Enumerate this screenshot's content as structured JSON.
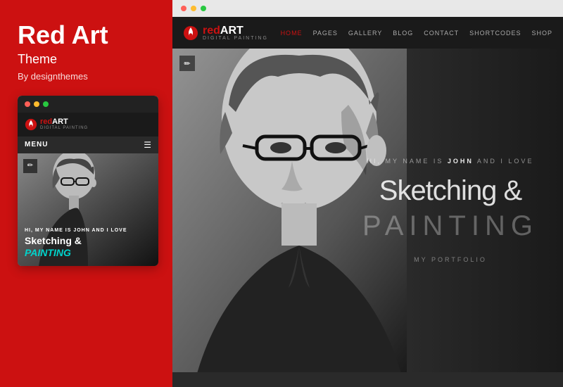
{
  "left": {
    "title": "Red Art",
    "subtitle": "Theme",
    "author": "By designthemes",
    "mobile_preview": {
      "logo_red": "red",
      "logo_bold": "ART",
      "logo_sub": "DIGITAL PAINTING",
      "menu_label": "MENU",
      "intro": "HI, MY NAME IS",
      "intro_name": "JOHN",
      "intro_suffix": "AND I LOVE",
      "heading1": "Sketching &",
      "heading2": "PAINTING"
    }
  },
  "right": {
    "desktop_preview": {
      "logo_red": "red",
      "logo_bold": "ART",
      "logo_sub": "DIGITAL PAINTING",
      "nav_links": [
        "HOME",
        "PAGES",
        "GALLERY",
        "BLOG",
        "CONTACT",
        "SHORTCODES",
        "SHOP"
      ],
      "active_nav": "HOME",
      "intro": "HI, MY NAME IS",
      "intro_name": "JOHN",
      "intro_suffix": "AND I LOVE",
      "heading1": "Sketching &",
      "heading2": "PAINTING",
      "portfolio_label": "MY PORTFOLIO"
    }
  },
  "colors": {
    "red": "#cc1111",
    "accent": "#00d4cc",
    "dark": "#1a1a1a"
  },
  "icons": {
    "pencil": "✏",
    "hamburger": "≡",
    "dot1": "●",
    "dot2": "●",
    "dot3": "●"
  }
}
